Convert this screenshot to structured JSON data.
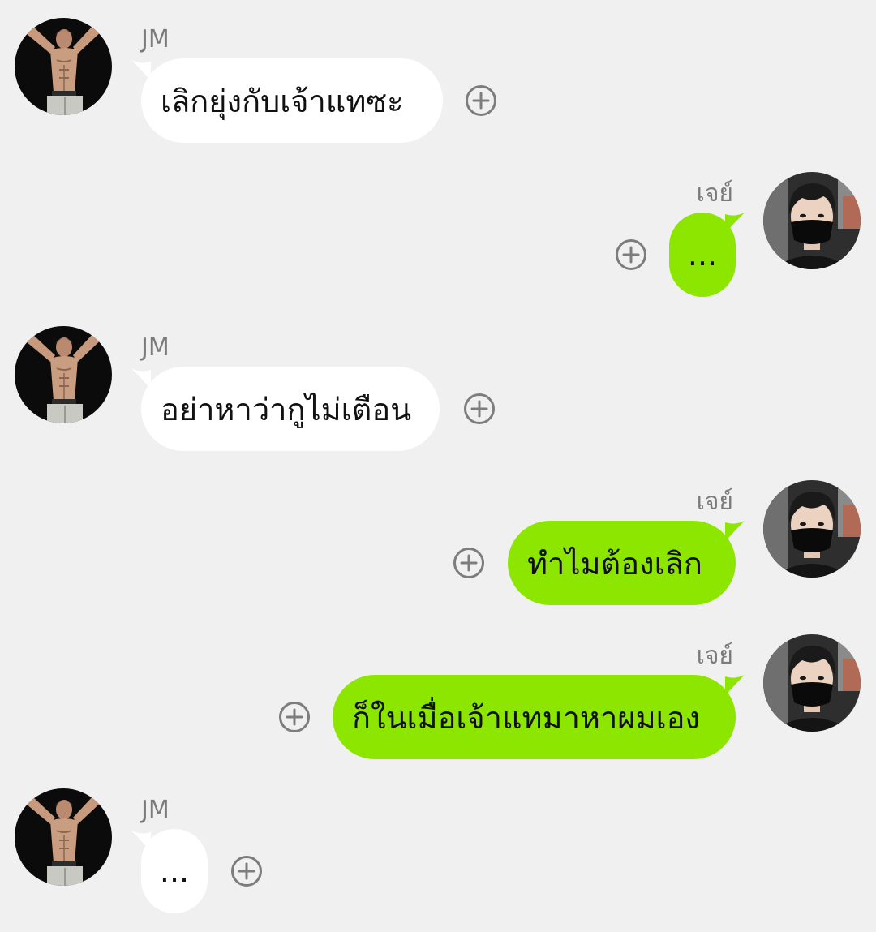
{
  "colors": {
    "background": "#f0f0f0",
    "incoming_bubble": "#ffffff",
    "outgoing_bubble": "#8de600",
    "sender_name": "#7a7a7a",
    "text": "#111111",
    "plus_icon": "#7d7d7d"
  },
  "messages": [
    {
      "direction": "incoming",
      "sender": "JM",
      "text": "เลิกยุ่งกับเจ้าแทซะ",
      "avatar_icon": "shirtless-man-avatar-icon",
      "action_icon": "add-reaction-icon"
    },
    {
      "direction": "outgoing",
      "sender": "เจย์",
      "text": "...",
      "avatar_icon": "masked-man-avatar-icon",
      "action_icon": "add-reaction-icon"
    },
    {
      "direction": "incoming",
      "sender": "JM",
      "text": "อย่าหาว่ากูไม่เตือน",
      "avatar_icon": "shirtless-man-avatar-icon",
      "action_icon": "add-reaction-icon"
    },
    {
      "direction": "outgoing",
      "sender": "เจย์",
      "text": "ทำไมต้องเลิก",
      "avatar_icon": "masked-man-avatar-icon",
      "action_icon": "add-reaction-icon"
    },
    {
      "direction": "outgoing",
      "sender": "เจย์",
      "text": "ก็ในเมื่อเจ้าแทมาหาผมเอง",
      "avatar_icon": "masked-man-avatar-icon",
      "action_icon": "add-reaction-icon"
    },
    {
      "direction": "incoming",
      "sender": "JM",
      "text": "...",
      "avatar_icon": "shirtless-man-avatar-icon",
      "action_icon": "add-reaction-icon"
    }
  ]
}
